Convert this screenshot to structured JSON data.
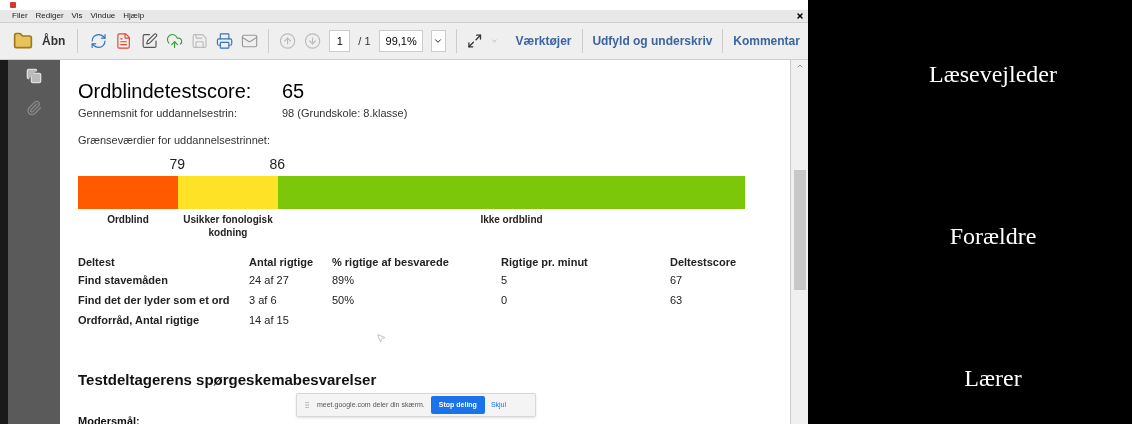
{
  "menu": [
    "Filer",
    "Rediger",
    "Vis",
    "Vindue",
    "Hjælp"
  ],
  "toolbar": {
    "open_label": "Åbn",
    "page_value": "1",
    "page_total": "/ 1",
    "zoom": "99,1%",
    "panels": [
      "Værktøjer",
      "Udfyld og underskriv",
      "Kommentar"
    ]
  },
  "document": {
    "score_label": "Ordblindetestscore:",
    "score": "65",
    "average_label": "Gennemsnit for uddannelsestrin:",
    "average": "98 (Grundskole: 8.klasse)",
    "thresholds_label": "Grænseværdier for uddannelsestrinnet:",
    "thresholds": [
      "79",
      "86"
    ],
    "scale": [
      {
        "label": "Ordblind",
        "color": "#ff5a00"
      },
      {
        "label": "Usikker fonologisk kodning",
        "color": "#fde225"
      },
      {
        "label": "Ikke ordblind",
        "color": "#7cc70a"
      }
    ],
    "table": {
      "columns": [
        "Deltest",
        "Antal rigtige",
        "% rigtige af besvarede",
        "Rigtige pr. minut",
        "Deltestscore"
      ],
      "rows": [
        [
          "Find stavemåden",
          "24 af 27",
          "89%",
          "5",
          "67"
        ],
        [
          "Find det der lyder som et ord",
          "3 af 6",
          "50%",
          "0",
          "63"
        ],
        [
          "Ordforråd, Antal rigtige",
          "14 af 15"
        ]
      ]
    },
    "section_title": "Testdeltagerens spørgeskemabesvarelser",
    "field_label": "Modersmål:"
  },
  "share_bar": {
    "message": "meet.google.com deler din skærm.",
    "stop_button": "Stop deling",
    "hide_link": "Skjul"
  },
  "roles": [
    "Læsevejleder",
    "Forældre",
    "Lærer"
  ]
}
